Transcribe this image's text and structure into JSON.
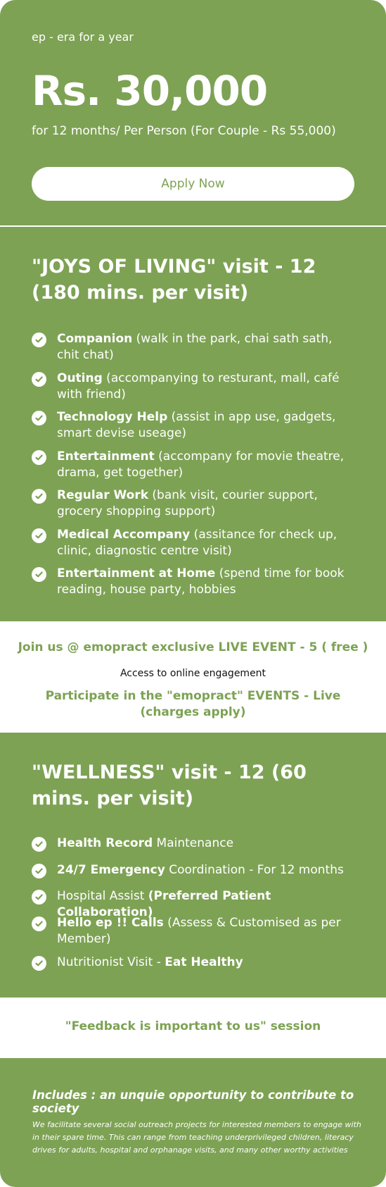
{
  "plan": {
    "eyebrow": "ep - era for a year",
    "price": "Rs. 30,000",
    "subtitle": "for 12 months/ Per Person (For Couple - Rs 55,000)",
    "apply_label": "Apply Now"
  },
  "joys": {
    "title": "\"JOYS OF LIVING\" visit - 12 (180 mins. per visit)",
    "items": [
      {
        "bold": "Companion",
        "text": " (walk in the park, chai sath sath, chit chat)"
      },
      {
        "bold": "Outing",
        "text": " (accompanying to resturant, mall, café with friend)"
      },
      {
        "bold": "Technology Help",
        "text": " (assist in app use, gadgets, smart devise useage)"
      },
      {
        "bold": "Entertainment",
        "text": " (accompany for movie theatre, drama, get together)"
      },
      {
        "bold": "Regular Work",
        "text": " (bank visit, courier support, grocery shopping support)"
      },
      {
        "bold": "Medical Accompany",
        "text": " (assitance for check up, clinic, diagnostic centre visit)"
      },
      {
        "bold": "Entertainment at Home",
        "text": " (spend time for book reading, house party, hobbies"
      }
    ]
  },
  "event": {
    "title": "Join us @ emopract exclusive LIVE EVENT - 5 ( free )",
    "subtitle": "Access to online engagement",
    "participate": "Participate in the \"emopract\" EVENTS - Live (charges apply)"
  },
  "wellness": {
    "title": "\"WELLNESS\" visit - 12 (60 mins. per visit)",
    "items": [
      {
        "pre": "",
        "bold": "Health Record",
        "text": " Maintenance"
      },
      {
        "pre": "",
        "bold": "24/7 Emergency",
        "text": " Coordination - For 12 months"
      },
      {
        "pre": "Hospital Assist ",
        "bold": "(Preferred Patient Collaboration)",
        "text": ""
      },
      {
        "pre": "",
        "bold": "Hello ep !! Calls",
        "text": " (Assess & Customised as per Member)"
      },
      {
        "pre": "Nutritionist Visit - ",
        "bold": "Eat Healthy",
        "text": ""
      }
    ]
  },
  "feedback": {
    "text": "\"Feedback is important to us\" session"
  },
  "includes": {
    "title": "Includes : an unquie opportunity to contribute to society",
    "description": "We facilitate several social outreach projects for interested members to  engage with in their spare  time. This can range from teaching underprivileged children, literacy drives for adults, hospital and orphanage  visits, and many other worthy activities"
  },
  "colors": {
    "brand_green": "#7da254",
    "white": "#ffffff"
  },
  "icons": {
    "list_bullet": "check-circle-icon"
  }
}
